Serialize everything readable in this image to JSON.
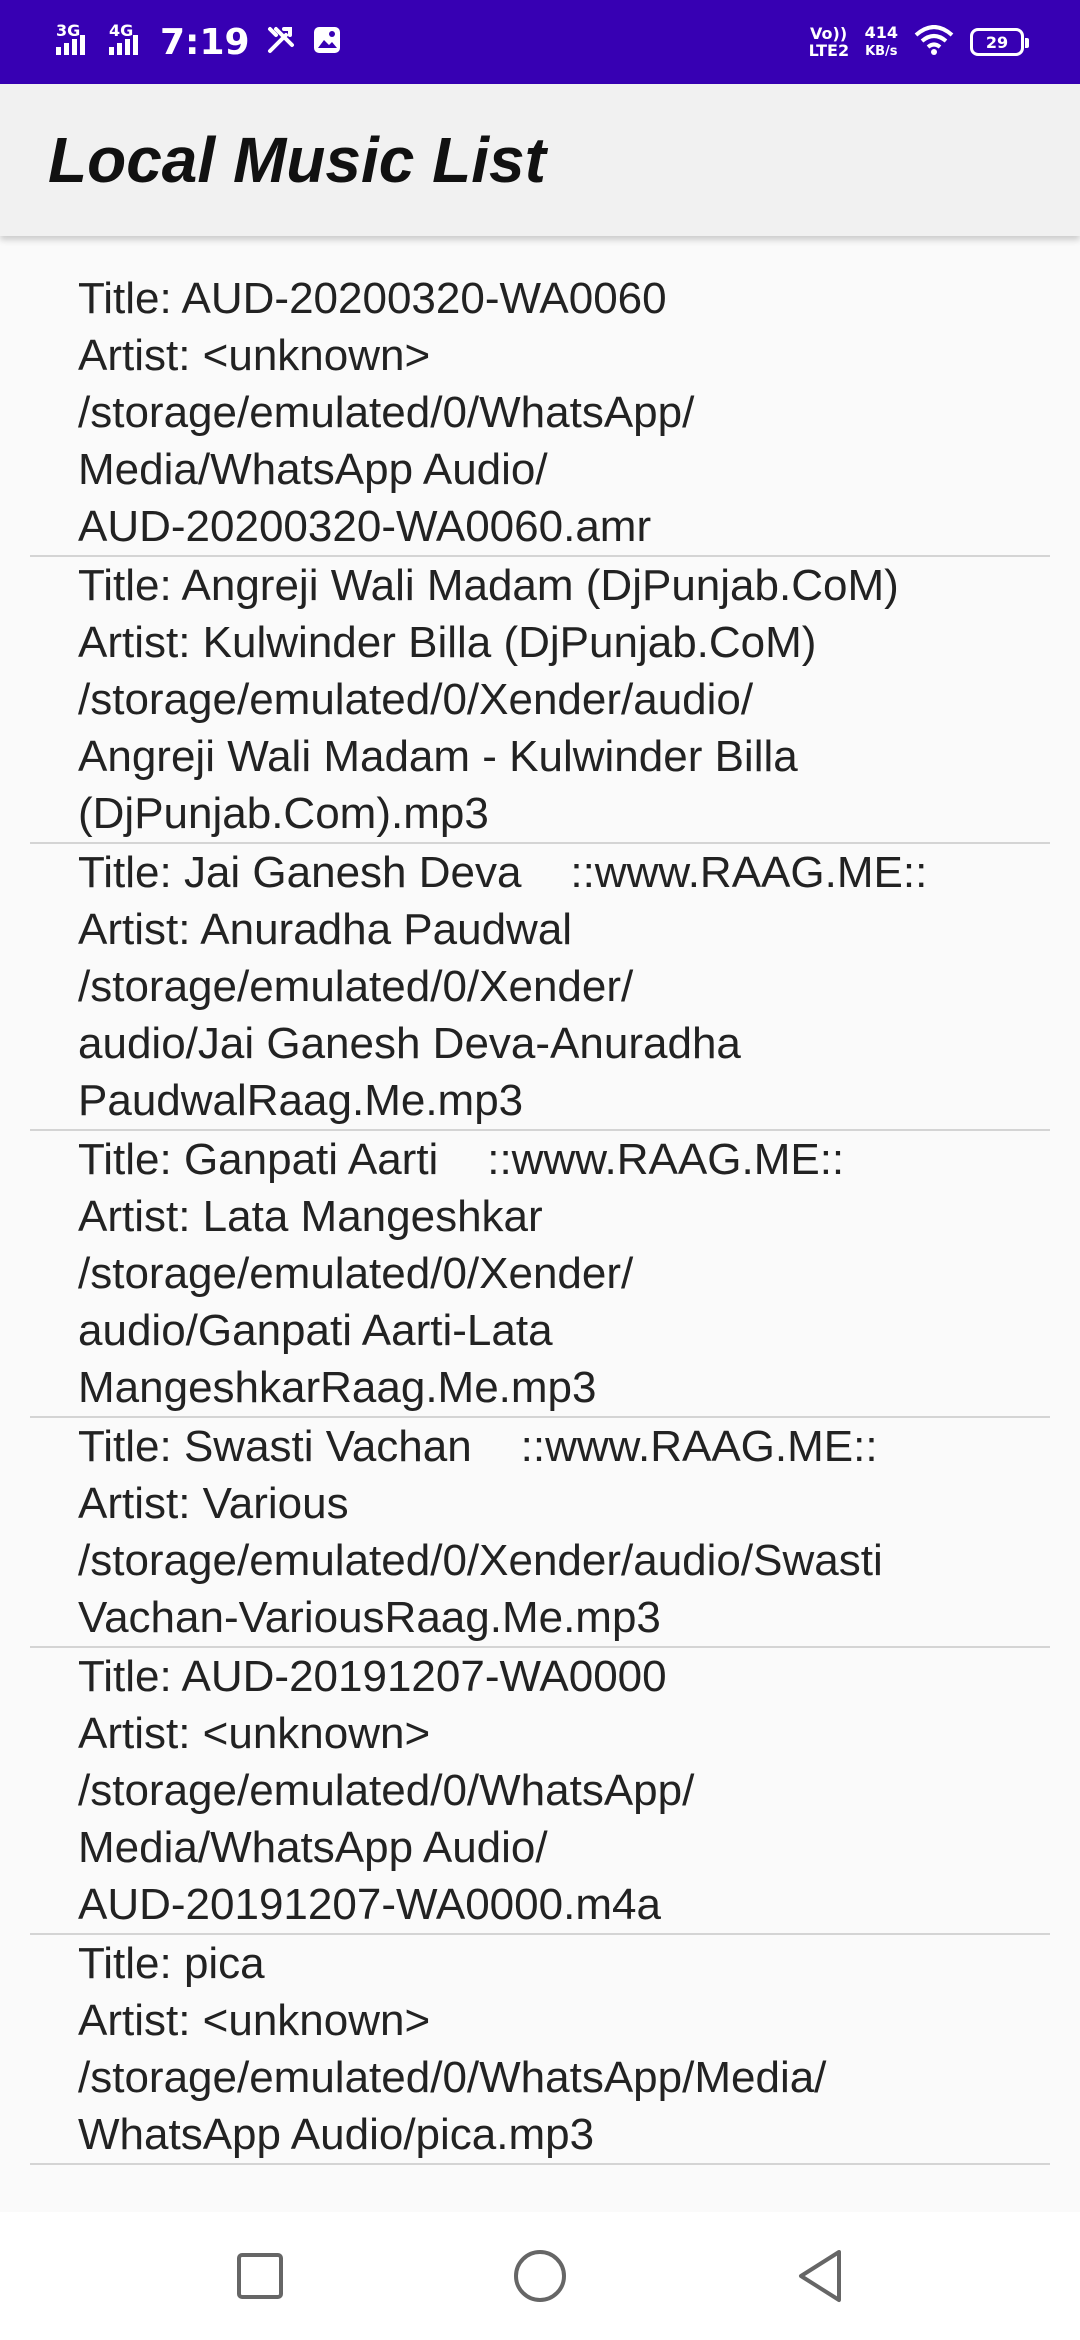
{
  "status_bar": {
    "net1": "3G",
    "net2": "4G",
    "time": "7:19",
    "volte": "Vo)) LTE2",
    "speed_value": "414",
    "speed_unit": "KB/s",
    "battery": "29"
  },
  "app_bar": {
    "title": "Local Music List"
  },
  "songs": [
    {
      "title_line": "Title: AUD-20200320-WA0060",
      "artist_line": "Artist: <unknown>",
      "path_lines": [
        "/storage/emulated/0/WhatsApp/",
        "Media/WhatsApp Audio/",
        "AUD-20200320-WA0060.amr"
      ]
    },
    {
      "title_line": "Title: Angreji Wali Madam (DjPunjab.CoM)",
      "artist_line": "Artist: Kulwinder Billa (DjPunjab.CoM)",
      "path_lines": [
        "/storage/emulated/0/Xender/audio/",
        "Angreji Wali Madam - Kulwinder Billa",
        "(DjPunjab.Com).mp3"
      ]
    },
    {
      "title_line": "Title: Jai Ganesh Deva    ::www.RAAG.ME::",
      "artist_line": "Artist: Anuradha Paudwal",
      "path_lines": [
        "/storage/emulated/0/Xender/",
        "audio/Jai Ganesh Deva-Anuradha",
        "PaudwalRaag.Me.mp3"
      ]
    },
    {
      "title_line": "Title: Ganpati Aarti    ::www.RAAG.ME::",
      "artist_line": "Artist: Lata Mangeshkar",
      "path_lines": [
        "/storage/emulated/0/Xender/",
        "audio/Ganpati Aarti-Lata",
        "MangeshkarRaag.Me.mp3"
      ]
    },
    {
      "title_line": "Title: Swasti Vachan    ::www.RAAG.ME::",
      "artist_line": "Artist: Various",
      "path_lines": [
        "/storage/emulated/0/Xender/audio/Swasti",
        "Vachan-VariousRaag.Me.mp3"
      ]
    },
    {
      "title_line": "Title: AUD-20191207-WA0000",
      "artist_line": "Artist: <unknown>",
      "path_lines": [
        "/storage/emulated/0/WhatsApp/",
        "Media/WhatsApp Audio/",
        "AUD-20191207-WA0000.m4a"
      ]
    },
    {
      "title_line": "Title: pica",
      "artist_line": "Artist: <unknown>",
      "path_lines": [
        "/storage/emulated/0/WhatsApp/Media/",
        "WhatsApp Audio/pica.mp3"
      ]
    }
  ],
  "nav": {
    "recents_icon": "square-icon",
    "home_icon": "circle-icon",
    "back_icon": "triangle-back-icon"
  }
}
